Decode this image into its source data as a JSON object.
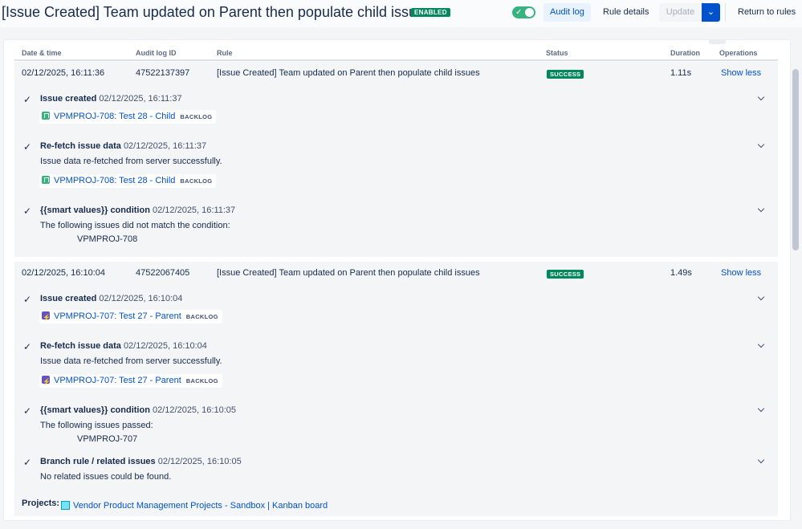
{
  "header": {
    "title": "[Issue Created] Team updated on Parent then populate child issues",
    "status_badge": "ENABLED",
    "toggle_check": "✓",
    "audit_log_label": "Audit log",
    "rule_details_label": "Rule details",
    "update_label": "Update",
    "dropdown_icon": "⌄",
    "return_label": "Return to rules"
  },
  "table": {
    "columns": [
      "Date & time",
      "Audit log ID",
      "Rule",
      "Status",
      "Duration",
      "Operations"
    ]
  },
  "entries": [
    {
      "date": "02/12/2025, 16:11:36",
      "id": "47522137397",
      "rule": "[Issue Created] Team updated on Parent then populate child issues",
      "status": "SUCCESS",
      "duration": "1.11s",
      "operation": "Show less",
      "steps": [
        {
          "title": "Issue created",
          "time": "02/12/2025, 16:11:37",
          "issue": "VPMPROJ-708: Test 28 - Child",
          "issue_status": "BACKLOG",
          "issue_type_icon": "story-icon"
        },
        {
          "title": "Re-fetch issue data",
          "time": "02/12/2025, 16:11:37",
          "message": "Issue data re-fetched from server successfully.",
          "issue": "VPMPROJ-708: Test 28 - Child",
          "issue_status": "BACKLOG",
          "issue_type_icon": "story-icon"
        },
        {
          "title": "{{smart values}} condition",
          "time": "02/12/2025, 16:11:37",
          "message": "The following issues did not match the condition:",
          "detail": "VPMPROJ-708"
        }
      ]
    },
    {
      "date": "02/12/2025, 16:10:04",
      "id": "47522067405",
      "rule": "[Issue Created] Team updated on Parent then populate child issues",
      "status": "SUCCESS",
      "duration": "1.49s",
      "operation": "Show less",
      "steps": [
        {
          "title": "Issue created",
          "time": "02/12/2025, 16:10:04",
          "issue": "VPMPROJ-707: Test 27 - Parent",
          "issue_status": "BACKLOG",
          "issue_type_icon": "epic-icon"
        },
        {
          "title": "Re-fetch issue data",
          "time": "02/12/2025, 16:10:04",
          "message": "Issue data re-fetched from server successfully.",
          "issue": "VPMPROJ-707: Test 27 - Parent",
          "issue_status": "BACKLOG",
          "issue_type_icon": "epic-icon"
        },
        {
          "title": "{{smart values}} condition",
          "time": "02/12/2025, 16:10:05",
          "message": "The following issues passed:",
          "detail": "VPMPROJ-707"
        },
        {
          "title": "Branch rule / related issues",
          "time": "02/12/2025, 16:10:05",
          "message": "No related issues could be found."
        }
      ],
      "projects_label": "Projects:",
      "project_link": "Vendor Product Management Projects - Sandbox | Kanban board"
    }
  ],
  "check_glyph": "✓",
  "colors": {
    "success": "#00875a",
    "link": "#0052cc",
    "primary_button": "#0052cc",
    "toggle_on": "#36b37e"
  }
}
